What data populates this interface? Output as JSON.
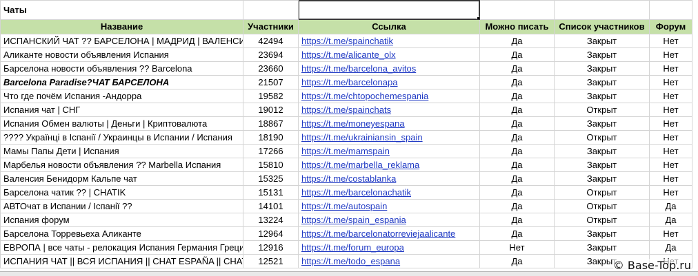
{
  "sheet": {
    "title": "Чаты",
    "headers": [
      "Название",
      "Участники",
      "Ссылка",
      "Можно писать",
      "Список участников",
      "Форум"
    ],
    "rows": [
      {
        "name": "ИСПАНСКИЙ ЧАТ ?? БАРСЕЛОНА | МАДРИД | ВАЛЕНСИЯ",
        "members": "42494",
        "link": "https://t.me/spainchatik",
        "write": "Да",
        "list": "Закрыт",
        "forum": "Нет"
      },
      {
        "name": "Аликанте новости объявления Испания",
        "members": "23694",
        "link": "https://t.me/alicante_olx",
        "write": "Да",
        "list": "Закрыт",
        "forum": "Нет"
      },
      {
        "name": "Барселона новости объявления ?? Barcelona",
        "members": "23660",
        "link": "https://t.me/barcelona_avitos",
        "write": "Да",
        "list": "Закрыт",
        "forum": "Нет"
      },
      {
        "name": "Barcelona Paradise?ЧАТ БАРСЕЛОНА",
        "members": "21507",
        "link": "https://t.me/barcelonapa",
        "write": "Да",
        "list": "Закрыт",
        "forum": "Нет",
        "style": "italic"
      },
      {
        "name": "Что где почём Испания -Андорра",
        "members": "19582",
        "link": "https://t.me/chtopochemespania",
        "write": "Да",
        "list": "Закрыт",
        "forum": "Нет"
      },
      {
        "name": "Испания чат | СНГ",
        "members": "19012",
        "link": "https://t.me/spainchats",
        "write": "Да",
        "list": "Открыт",
        "forum": "Нет"
      },
      {
        "name": "Испания Обмен валюты | Деньги | Криптовалюта",
        "members": "18867",
        "link": "https://t.me/moneyespana",
        "write": "Да",
        "list": "Закрыт",
        "forum": "Нет"
      },
      {
        "name": "???? Українці в Іспанії / Украинцы в Испании / Испания",
        "members": "18190",
        "link": "https://t.me/ukrainiansin_spain",
        "write": "Да",
        "list": "Открыт",
        "forum": "Нет"
      },
      {
        "name": "Мамы Папы Дети | Испания",
        "members": "17266",
        "link": "https://t.me/mamspain",
        "write": "Да",
        "list": "Закрыт",
        "forum": "Нет"
      },
      {
        "name": "Марбелья новости объявления ?? Marbella Испания",
        "members": "15810",
        "link": "https://t.me/marbella_reklama",
        "write": "Да",
        "list": "Закрыт",
        "forum": "Нет"
      },
      {
        "name": "Валенсия Бенидорм Кальпе чат",
        "members": "15325",
        "link": "https://t.me/costablanka",
        "write": "Да",
        "list": "Закрыт",
        "forum": "Нет"
      },
      {
        "name": "Барселона чатик ?? | CHATIK",
        "members": "15131",
        "link": "https://t.me/barcelonachatik",
        "write": "Да",
        "list": "Открыт",
        "forum": "Нет"
      },
      {
        "name": "АВТОчат в Испании / Іспанії ??",
        "members": "14101",
        "link": "https://t.me/autospain",
        "write": "Да",
        "list": "Открыт",
        "forum": "Да"
      },
      {
        "name": "Испания форум",
        "members": "13224",
        "link": "https://t.me/spain_espania",
        "write": "Да",
        "list": "Открыт",
        "forum": "Да"
      },
      {
        "name": "Барселона Торревьеха Аликанте",
        "members": "12964",
        "link": "https://t.me/barcelonatorreviejaalicante",
        "write": "Да",
        "list": "Закрыт",
        "forum": "Нет"
      },
      {
        "name": "ЕВРОПА | все чаты - релокация Испания Германия Греция",
        "members": "12916",
        "link": "https://t.me/forum_europa",
        "write": "Нет",
        "list": "Закрыт",
        "forum": "Да"
      },
      {
        "name": "ИСПАНИЯ ЧАТ || ВСЯ ИСПАНИЯ || CHAT ESPAÑA || CHAT",
        "members": "12521",
        "link": "https://t.me/todo_espana",
        "write": "Да",
        "list": "Закрыт",
        "forum": "Нет"
      }
    ]
  },
  "watermark": "© Base-Top.ru"
}
